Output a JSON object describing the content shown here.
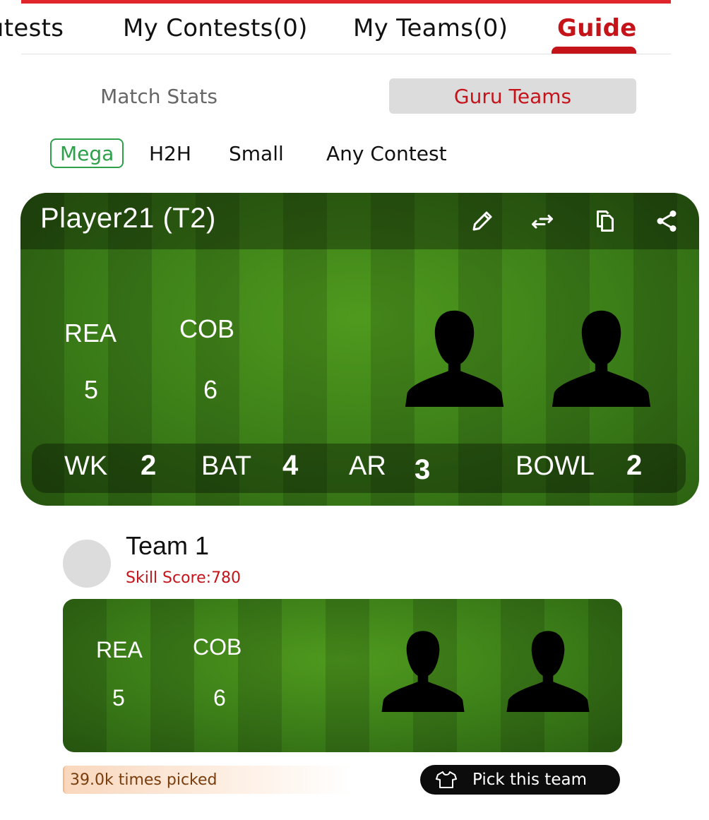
{
  "tabs": {
    "items": [
      {
        "label": "ıtests"
      },
      {
        "label": "My Contests(0)"
      },
      {
        "label": "My Teams(0)"
      },
      {
        "label": "Guide"
      }
    ],
    "active_index": 3
  },
  "segments": {
    "match_stats": "Match Stats",
    "guru_teams": "Guru Teams",
    "active": "Guru Teams"
  },
  "filters": {
    "items": [
      "Mega",
      "H2H",
      "Small",
      "Any Contest"
    ],
    "active": "Mega"
  },
  "main_team": {
    "name": "Player21 (T2)",
    "icons": [
      "edit-icon",
      "swap-icon",
      "copy-icon",
      "share-icon"
    ],
    "teams": [
      {
        "code": "REA",
        "count": "5"
      },
      {
        "code": "COB",
        "count": "6"
      }
    ],
    "roles": [
      {
        "label": "WK",
        "count": "2"
      },
      {
        "label": "BAT",
        "count": "4"
      },
      {
        "label": "AR",
        "count": "3"
      },
      {
        "label": "BOWL",
        "count": "2"
      }
    ]
  },
  "guru_team": {
    "title": "Team 1",
    "skill_score": "Skill Score:780",
    "teams": [
      {
        "code": "REA",
        "count": "5"
      },
      {
        "code": "COB",
        "count": "6"
      }
    ],
    "times_picked": "39.0k times picked",
    "pick_button": "Pick this team"
  },
  "colors": {
    "accent_red": "#c4141a",
    "active_green": "#2ea04a",
    "grass": "#3b7d18"
  }
}
